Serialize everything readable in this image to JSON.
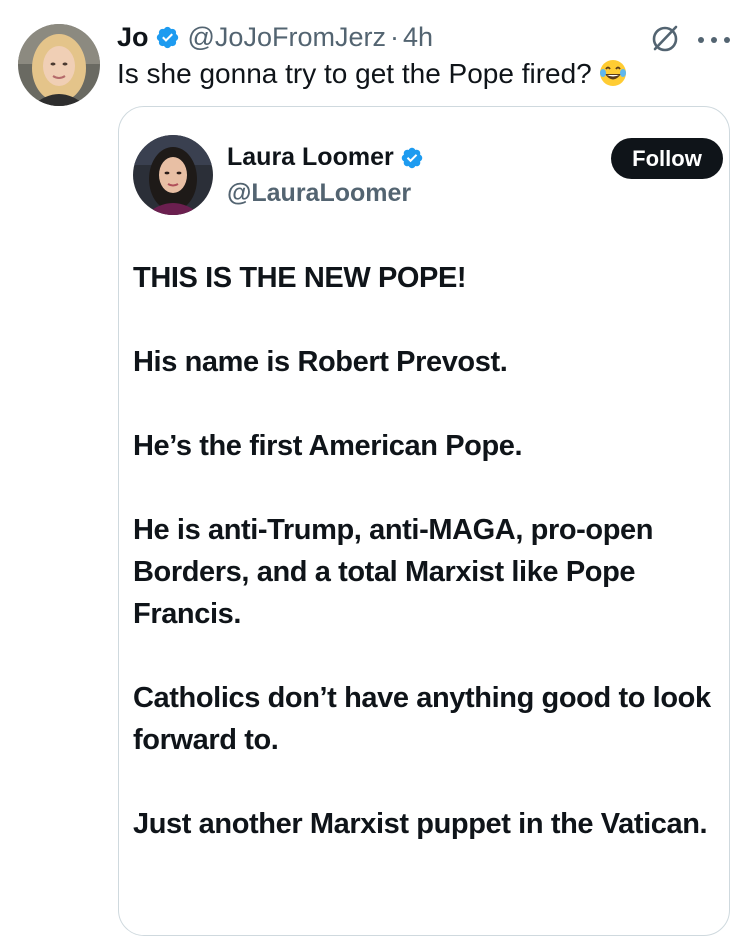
{
  "post": {
    "display_name": "Jo",
    "handle": "@JoJoFromJerz",
    "separator": "·",
    "time": "4h",
    "text": "Is she gonna try to get the Pope fired?",
    "emoji": "face-with-tears-of-joy-emoji",
    "icons": {
      "verified": "verified-badge-icon",
      "grok": "grok-icon",
      "more": "more-options-icon"
    }
  },
  "quoted_post": {
    "display_name": "Laura Loomer",
    "handle": "@LauraLoomer",
    "follow_label": "Follow",
    "paragraphs": [
      "THIS IS THE NEW POPE!",
      "His name is Robert Prevost.",
      "He’s the first American Pope.",
      "He is anti-Trump, anti-MAGA, pro-open Borders, and a total Marxist like Pope Francis.",
      "Catholics don’t have anything good to look forward to.",
      "Just another Marxist puppet in the Vatican."
    ]
  },
  "colors": {
    "verified_blue": "#1d9bf0",
    "text_primary": "#0f1419",
    "text_secondary": "#536471",
    "border": "#cfd9de",
    "follow_bg": "#0f1419"
  }
}
